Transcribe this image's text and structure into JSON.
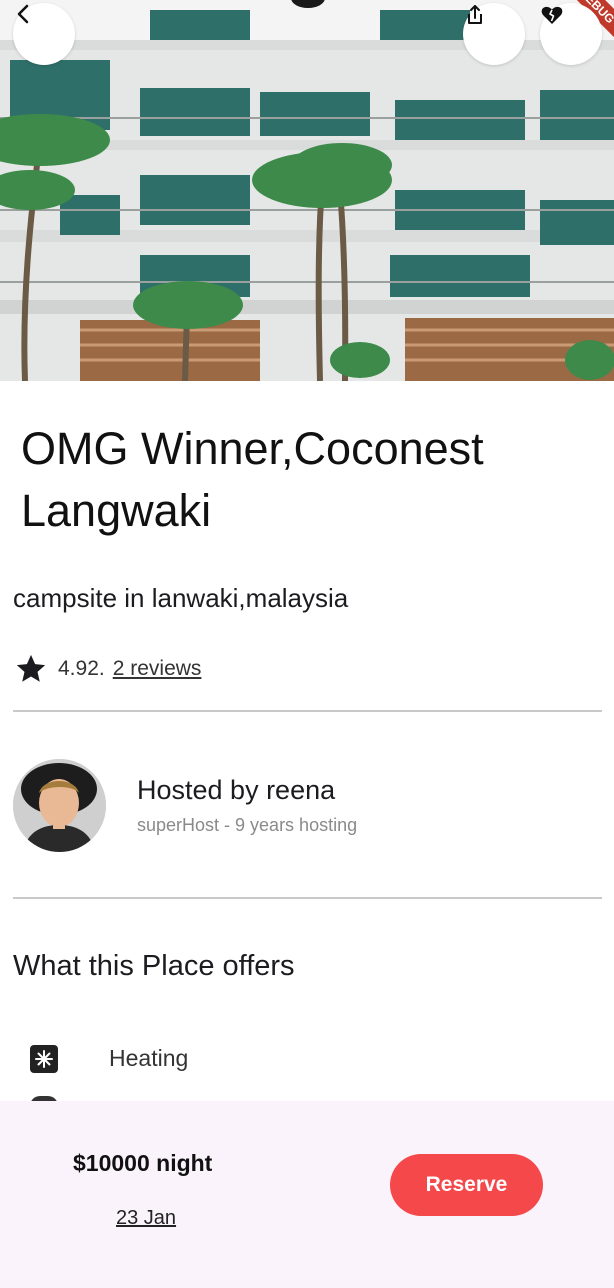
{
  "hero": {
    "image_alt": "hotel building with palm trees",
    "debug_banner": "DEBUG"
  },
  "header": {
    "back_icon": "chevron-left-icon",
    "share_icon": "share-icon",
    "favorite_icon": "broken-heart-icon"
  },
  "listing": {
    "title": "OMG Winner,Coconest Langwaki",
    "subtitle": "campsite in lanwaki,malaysia",
    "rating": "4.92.",
    "reviews_link": "2 reviews"
  },
  "host": {
    "name": "Hosted by reena",
    "meta": "superHost - 9 years hosting"
  },
  "offers": {
    "title": "What this Place offers",
    "items": [
      {
        "label": "Heating",
        "icon": "heating-icon"
      }
    ]
  },
  "booking": {
    "price": "$10000 night",
    "date": "23 Jan",
    "reserve_label": "Reserve"
  },
  "colors": {
    "accent": "#f4484a",
    "bottom_bar": "#fbf3fb"
  }
}
